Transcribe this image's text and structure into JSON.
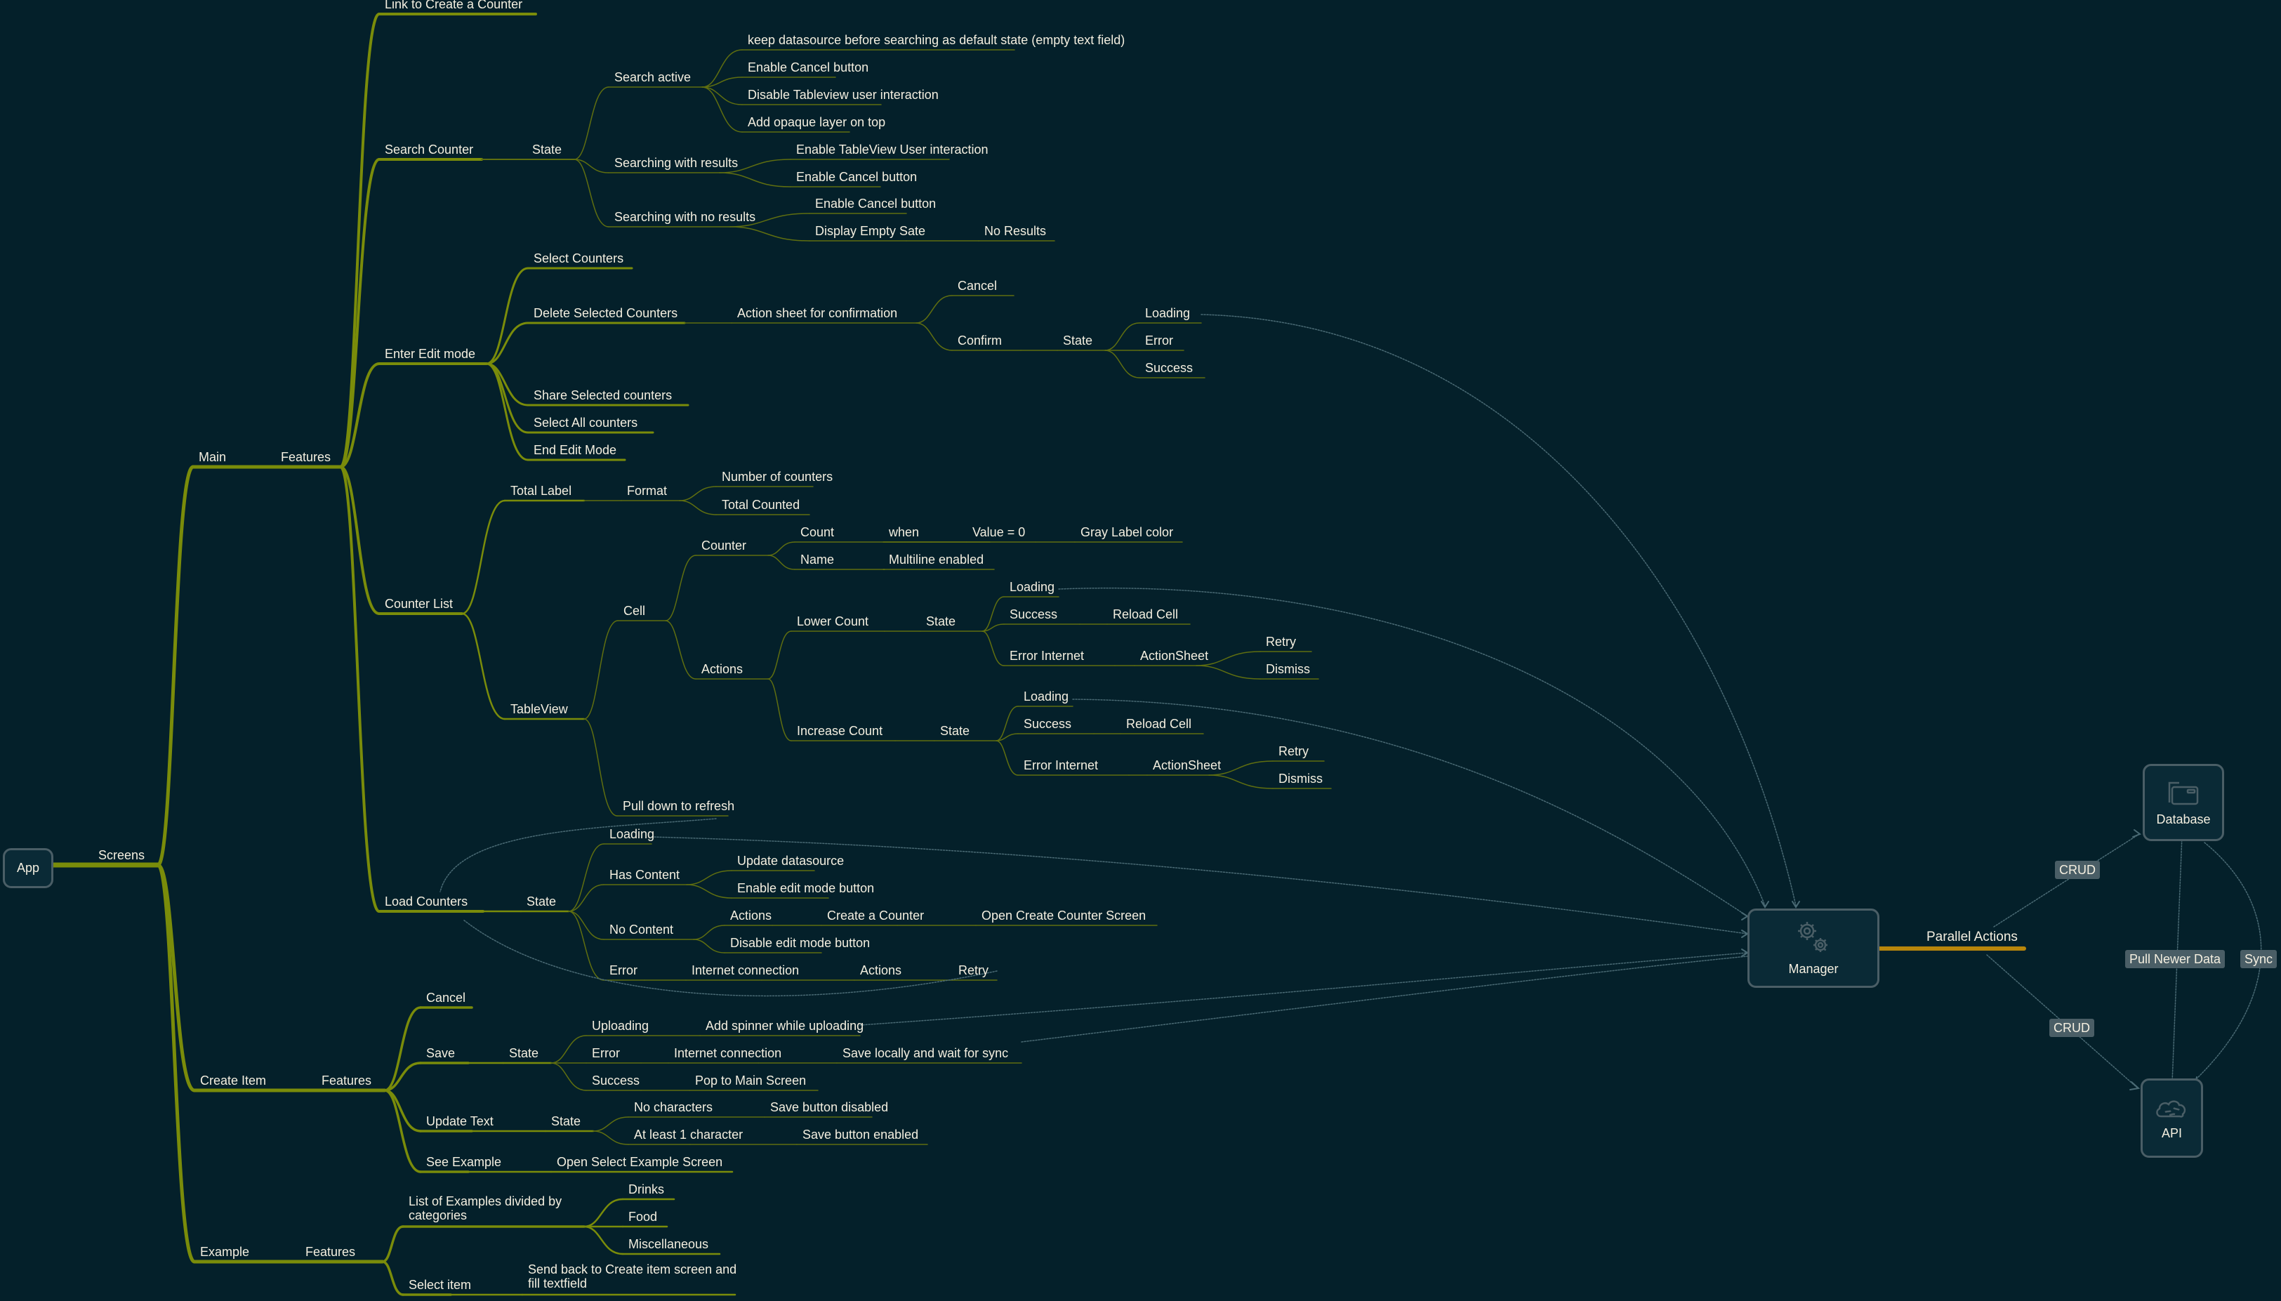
{
  "root": "App",
  "tree": {
    "screens": "Screens",
    "main": {
      "label": "Main",
      "features": "Features",
      "link_create": "Link to Create a Counter",
      "search_counter": "Search Counter",
      "search_state": "State",
      "search_active": "Search active",
      "search_active_items": [
        "keep datasource before searching as default state (empty text field)",
        "Enable Cancel button",
        "Disable Tableview user interaction",
        "Add opaque layer on top"
      ],
      "searching_results": "Searching with results",
      "searching_results_items": [
        "Enable TableView User interaction",
        "Enable Cancel button"
      ],
      "searching_no_results": "Searching with no results",
      "searching_no_results_items": [
        "Enable Cancel button",
        "Display Empty Sate"
      ],
      "no_results": "No Results",
      "edit_mode": "Enter Edit mode",
      "select_counters": "Select Counters",
      "delete_selected": "Delete Selected Counters",
      "action_sheet_confirm": "Action sheet for confirmation",
      "cancel": "Cancel",
      "confirm": "Confirm",
      "confirm_state": "State",
      "confirm_states": [
        "Loading",
        "Error",
        "Success"
      ],
      "share_selected": "Share Selected counters",
      "select_all": "Select All counters",
      "end_edit": "End Edit Mode",
      "counter_list": "Counter List",
      "total_label": "Total Label",
      "format": "Format",
      "format_items": [
        "Number of counters",
        "Total Counted"
      ],
      "tableview": "TableView",
      "cell": "Cell",
      "counter": "Counter",
      "count": "Count",
      "when": "when",
      "value_zero": "Value = 0",
      "gray_label": "Gray Label color",
      "name": "Name",
      "multiline": "Multiline enabled",
      "actions": "Actions",
      "lower_count": "Lower Count",
      "increase_count": "Increase Count",
      "state": "State",
      "loading": "Loading",
      "success": "Success",
      "reload_cell": "Reload Cell",
      "error_internet": "Error Internet",
      "action_sheet": "ActionSheet",
      "retry": "Retry",
      "dismiss": "Dismiss",
      "pull_refresh": "Pull down to refresh",
      "load_counters": "Load Counters",
      "load_state": "State",
      "has_content": "Has Content",
      "update_datasource": "Update datasource",
      "enable_edit": "Enable edit mode button",
      "no_content": "No Content",
      "create_counter": "Create a Counter",
      "open_create_counter": "Open Create Counter Screen",
      "disable_edit": "Disable edit mode button",
      "error": "Error",
      "internet_connection": "Internet connection"
    },
    "create_item": {
      "label": "Create Item",
      "features": "Features",
      "cancel": "Cancel",
      "save": "Save",
      "state": "State",
      "uploading": "Uploading",
      "add_spinner": "Add spinner while uploading",
      "error": "Error",
      "internet_connection": "Internet connection",
      "save_locally": "Save locally and wait for sync",
      "success": "Success",
      "pop_main": "Pop to Main Screen",
      "update_text": "Update Text",
      "no_characters": "No characters",
      "save_disabled": "Save button disabled",
      "at_least_one": "At least 1 character",
      "save_enabled": "Save button enabled",
      "see_example": "See Example",
      "open_select_example": "Open Select Example Screen"
    },
    "example": {
      "label": "Example",
      "features": "Features",
      "list_examples": "List of Examples divided by categories",
      "categories": [
        "Drinks",
        "Food",
        "Miscellaneous"
      ],
      "select_item": "Select item",
      "send_back": "Send back to Create item screen and fill textfield"
    }
  },
  "services": {
    "manager": "Manager",
    "parallel_actions": "Parallel Actions",
    "database": "Database",
    "api": "API",
    "crud_db": "CRUD",
    "crud_api": "CRUD",
    "pull_newer": "Pull Newer Data",
    "sync": "Sync"
  },
  "colors": {
    "background": "#04202a",
    "branch": "#7a8c0a",
    "branch_thin": "#5f6e10",
    "parallel": "#b8860b",
    "relation": "#4a6a74",
    "text": "#f4efe0"
  }
}
